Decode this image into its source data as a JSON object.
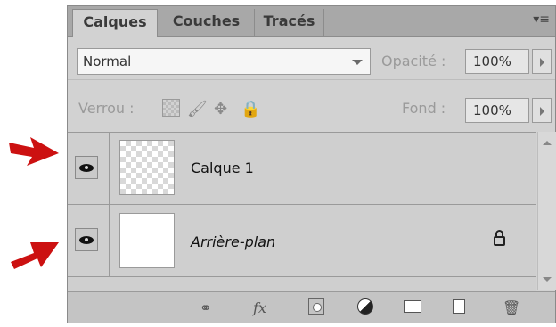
{
  "tabs": [
    {
      "label": "Calques",
      "active": true
    },
    {
      "label": "Couches",
      "active": false
    },
    {
      "label": "Tracés",
      "active": false
    }
  ],
  "panel_menu_icon": "panel-menu-icon",
  "blend_mode": {
    "value": "Normal"
  },
  "opacity": {
    "label": "Opacité :",
    "value": "100%"
  },
  "lock": {
    "label": "Verrou :",
    "icons": [
      "lock-transparent-pixels-icon",
      "lock-image-pixels-brush-icon",
      "lock-position-move-icon",
      "lock-all-padlock-icon"
    ]
  },
  "fill": {
    "label": "Fond :",
    "value": "100%"
  },
  "layers": [
    {
      "name": "Calque 1",
      "visible": true,
      "thumbnail": "transparent",
      "locked": false,
      "italic": false
    },
    {
      "name": "Arrière-plan",
      "visible": true,
      "thumbnail": "white",
      "locked": true,
      "italic": true
    }
  ],
  "footer_icons": [
    "link-layers-icon",
    "fx-layer-style-icon",
    "add-mask-icon",
    "adjustment-layer-icon",
    "new-group-folder-icon",
    "new-layer-icon",
    "trash-icon"
  ],
  "footer_fx_label": "fx",
  "annotation_color": "#cc1111"
}
